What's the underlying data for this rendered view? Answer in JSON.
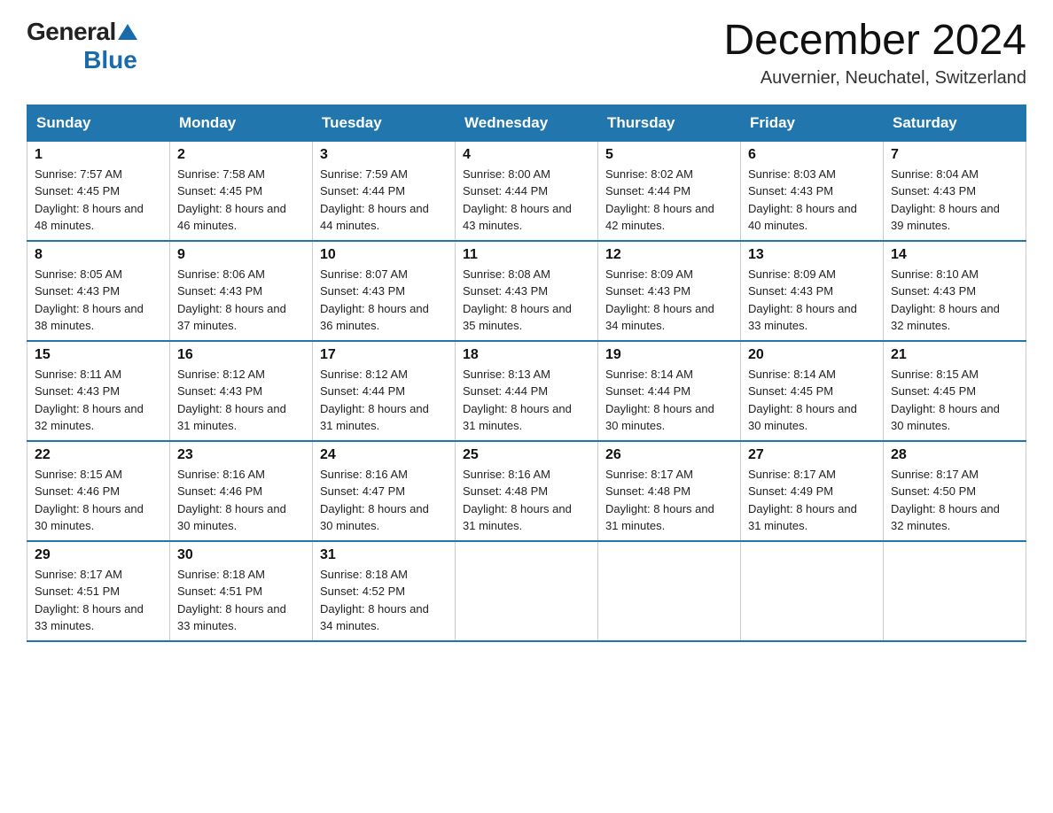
{
  "header": {
    "logo_general": "General",
    "logo_blue": "Blue",
    "title": "December 2024",
    "location": "Auvernier, Neuchatel, Switzerland"
  },
  "days_of_week": [
    "Sunday",
    "Monday",
    "Tuesday",
    "Wednesday",
    "Thursday",
    "Friday",
    "Saturday"
  ],
  "weeks": [
    [
      {
        "day": "1",
        "sunrise": "7:57 AM",
        "sunset": "4:45 PM",
        "daylight": "8 hours and 48 minutes."
      },
      {
        "day": "2",
        "sunrise": "7:58 AM",
        "sunset": "4:45 PM",
        "daylight": "8 hours and 46 minutes."
      },
      {
        "day": "3",
        "sunrise": "7:59 AM",
        "sunset": "4:44 PM",
        "daylight": "8 hours and 44 minutes."
      },
      {
        "day": "4",
        "sunrise": "8:00 AM",
        "sunset": "4:44 PM",
        "daylight": "8 hours and 43 minutes."
      },
      {
        "day": "5",
        "sunrise": "8:02 AM",
        "sunset": "4:44 PM",
        "daylight": "8 hours and 42 minutes."
      },
      {
        "day": "6",
        "sunrise": "8:03 AM",
        "sunset": "4:43 PM",
        "daylight": "8 hours and 40 minutes."
      },
      {
        "day": "7",
        "sunrise": "8:04 AM",
        "sunset": "4:43 PM",
        "daylight": "8 hours and 39 minutes."
      }
    ],
    [
      {
        "day": "8",
        "sunrise": "8:05 AM",
        "sunset": "4:43 PM",
        "daylight": "8 hours and 38 minutes."
      },
      {
        "day": "9",
        "sunrise": "8:06 AM",
        "sunset": "4:43 PM",
        "daylight": "8 hours and 37 minutes."
      },
      {
        "day": "10",
        "sunrise": "8:07 AM",
        "sunset": "4:43 PM",
        "daylight": "8 hours and 36 minutes."
      },
      {
        "day": "11",
        "sunrise": "8:08 AM",
        "sunset": "4:43 PM",
        "daylight": "8 hours and 35 minutes."
      },
      {
        "day": "12",
        "sunrise": "8:09 AM",
        "sunset": "4:43 PM",
        "daylight": "8 hours and 34 minutes."
      },
      {
        "day": "13",
        "sunrise": "8:09 AM",
        "sunset": "4:43 PM",
        "daylight": "8 hours and 33 minutes."
      },
      {
        "day": "14",
        "sunrise": "8:10 AM",
        "sunset": "4:43 PM",
        "daylight": "8 hours and 32 minutes."
      }
    ],
    [
      {
        "day": "15",
        "sunrise": "8:11 AM",
        "sunset": "4:43 PM",
        "daylight": "8 hours and 32 minutes."
      },
      {
        "day": "16",
        "sunrise": "8:12 AM",
        "sunset": "4:43 PM",
        "daylight": "8 hours and 31 minutes."
      },
      {
        "day": "17",
        "sunrise": "8:12 AM",
        "sunset": "4:44 PM",
        "daylight": "8 hours and 31 minutes."
      },
      {
        "day": "18",
        "sunrise": "8:13 AM",
        "sunset": "4:44 PM",
        "daylight": "8 hours and 31 minutes."
      },
      {
        "day": "19",
        "sunrise": "8:14 AM",
        "sunset": "4:44 PM",
        "daylight": "8 hours and 30 minutes."
      },
      {
        "day": "20",
        "sunrise": "8:14 AM",
        "sunset": "4:45 PM",
        "daylight": "8 hours and 30 minutes."
      },
      {
        "day": "21",
        "sunrise": "8:15 AM",
        "sunset": "4:45 PM",
        "daylight": "8 hours and 30 minutes."
      }
    ],
    [
      {
        "day": "22",
        "sunrise": "8:15 AM",
        "sunset": "4:46 PM",
        "daylight": "8 hours and 30 minutes."
      },
      {
        "day": "23",
        "sunrise": "8:16 AM",
        "sunset": "4:46 PM",
        "daylight": "8 hours and 30 minutes."
      },
      {
        "day": "24",
        "sunrise": "8:16 AM",
        "sunset": "4:47 PM",
        "daylight": "8 hours and 30 minutes."
      },
      {
        "day": "25",
        "sunrise": "8:16 AM",
        "sunset": "4:48 PM",
        "daylight": "8 hours and 31 minutes."
      },
      {
        "day": "26",
        "sunrise": "8:17 AM",
        "sunset": "4:48 PM",
        "daylight": "8 hours and 31 minutes."
      },
      {
        "day": "27",
        "sunrise": "8:17 AM",
        "sunset": "4:49 PM",
        "daylight": "8 hours and 31 minutes."
      },
      {
        "day": "28",
        "sunrise": "8:17 AM",
        "sunset": "4:50 PM",
        "daylight": "8 hours and 32 minutes."
      }
    ],
    [
      {
        "day": "29",
        "sunrise": "8:17 AM",
        "sunset": "4:51 PM",
        "daylight": "8 hours and 33 minutes."
      },
      {
        "day": "30",
        "sunrise": "8:18 AM",
        "sunset": "4:51 PM",
        "daylight": "8 hours and 33 minutes."
      },
      {
        "day": "31",
        "sunrise": "8:18 AM",
        "sunset": "4:52 PM",
        "daylight": "8 hours and 34 minutes."
      },
      null,
      null,
      null,
      null
    ]
  ]
}
